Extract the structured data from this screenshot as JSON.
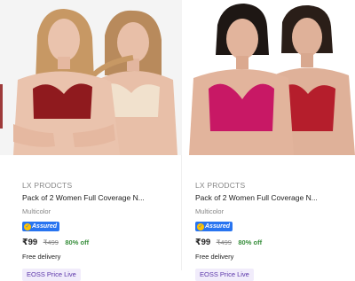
{
  "products": [
    {
      "brand": "LX PRODCTS",
      "title": "Pack of 2 Women Full Coverage N...",
      "variant": "Multicolor",
      "assured_label": "Assured",
      "price": "₹99",
      "mrp": "₹499",
      "discount": "80% off",
      "delivery": "Free delivery",
      "offer_tag": "EOSS Price Live",
      "image_colors": {
        "bg": "#f4f4f4",
        "bra1": "#8f1a1e",
        "bra2": "#f1e1cd",
        "skin": "#e8bfa8",
        "hair1": "#c79864",
        "hair2": "#b88a5c"
      }
    },
    {
      "brand": "LX PRODCTS",
      "title": "Pack of 2 Women Full Coverage N...",
      "variant": "Multicolor",
      "assured_label": "Assured",
      "price": "₹99",
      "mrp": "₹499",
      "discount": "80% off",
      "delivery": "Free delivery",
      "offer_tag": "EOSS Price Live",
      "image_colors": {
        "bg": "#ffffff",
        "bra1": "#c81865",
        "bra2": "#b51e2c",
        "skin": "#dfb199",
        "hair1": "#1e1714",
        "hair2": "#2a1e18"
      }
    }
  ],
  "theme": {
    "assured_blue": "#2874f0",
    "discount_green": "#388e3c",
    "tag_bg": "#f1ecfb",
    "tag_text": "#5b36a9"
  }
}
